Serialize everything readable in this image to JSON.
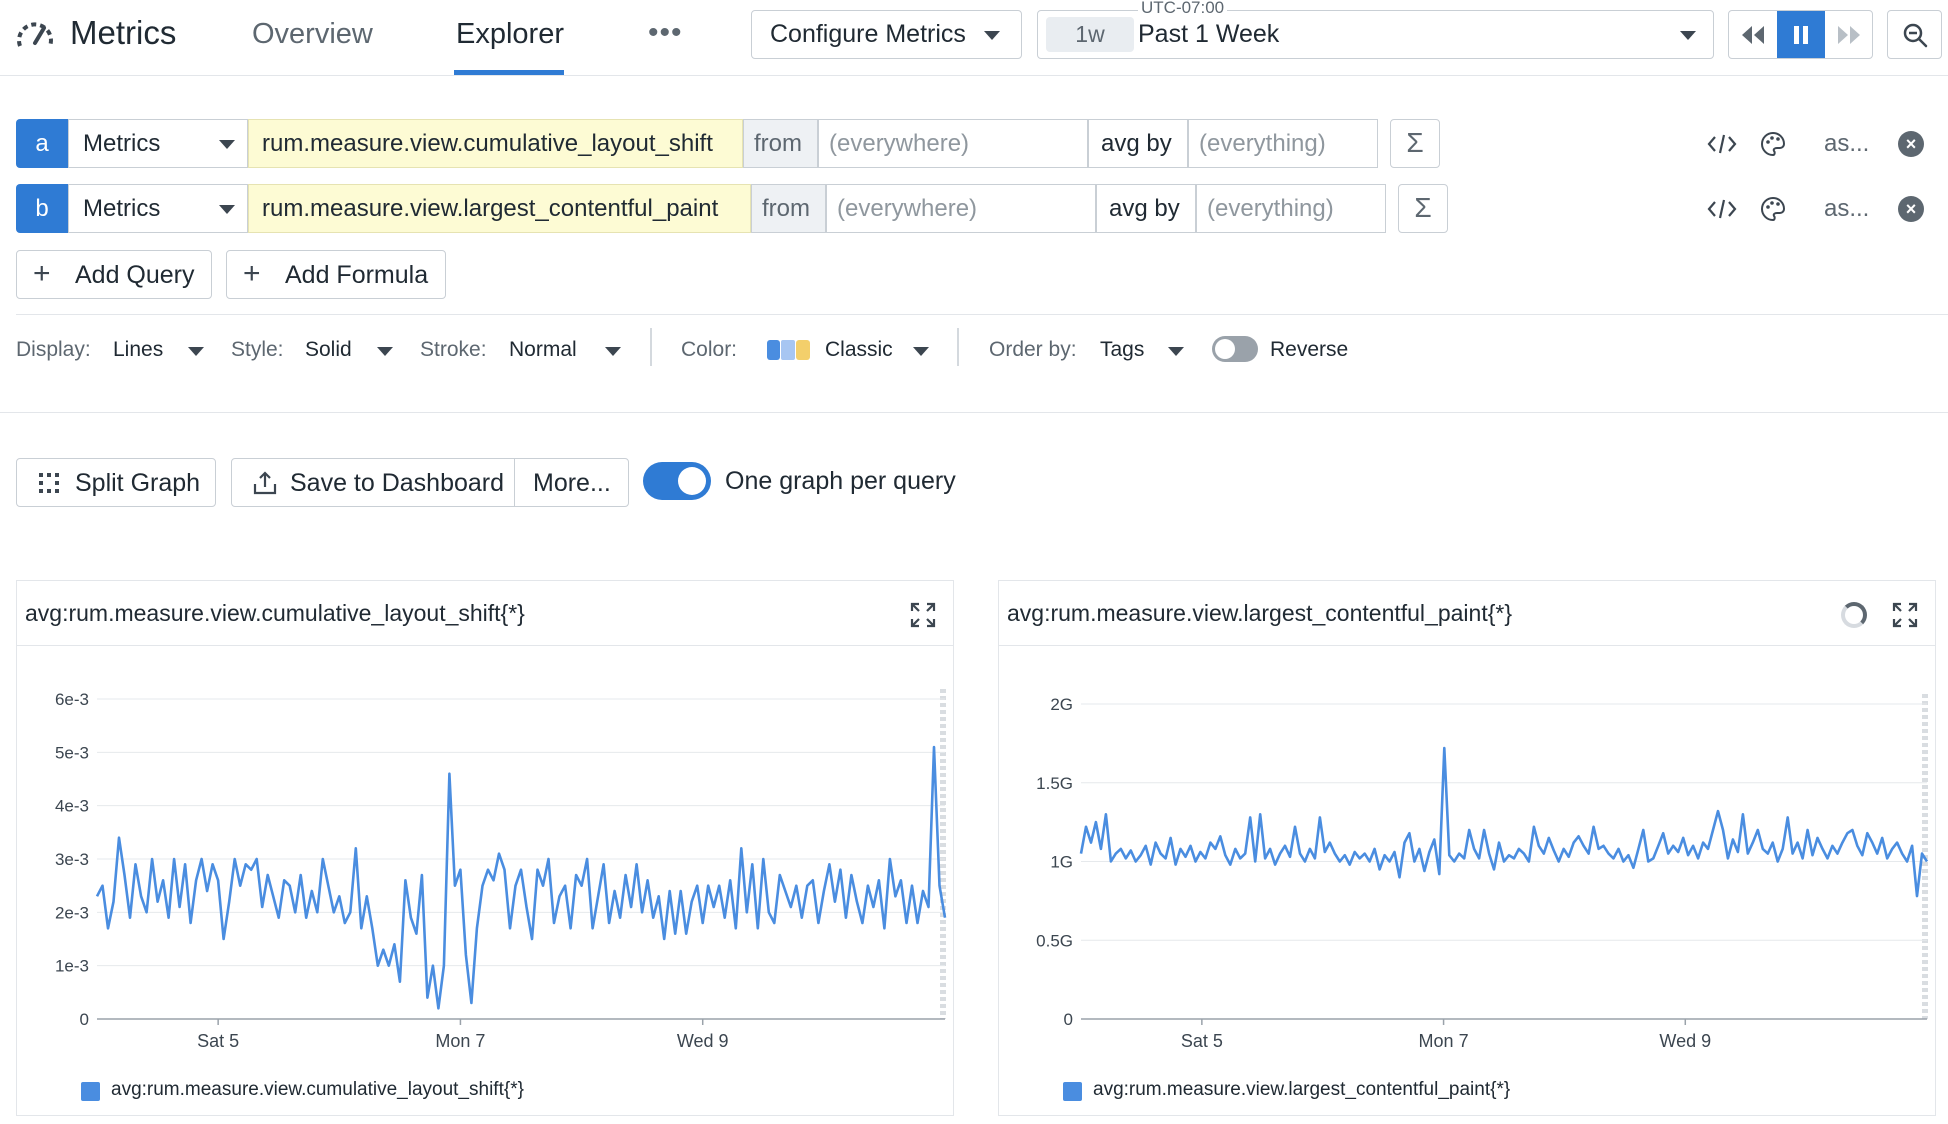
{
  "app": {
    "title": "Metrics",
    "tabs": [
      "Overview",
      "Explorer"
    ],
    "active_tab": "Explorer",
    "more_label": "•••",
    "configure_label": "Configure Metrics",
    "timezone": "UTC-07:00",
    "time_chip": "1w",
    "time_label": "Past 1 Week"
  },
  "queries": [
    {
      "letter": "a",
      "source": "Metrics",
      "metric": "rum.measure.view.cumulative_layout_shift",
      "from_label": "from",
      "from_placeholder": "(everywhere)",
      "avg_label": "avg by",
      "by_placeholder": "(everything)",
      "sigma": "Σ",
      "as_label": "as..."
    },
    {
      "letter": "b",
      "source": "Metrics",
      "metric": "rum.measure.view.largest_contentful_paint",
      "from_label": "from",
      "from_placeholder": "(everywhere)",
      "avg_label": "avg by",
      "by_placeholder": "(everything)",
      "sigma": "Σ",
      "as_label": "as..."
    }
  ],
  "add_query_label": "Add Query",
  "add_formula_label": "Add Formula",
  "display_options": {
    "display_key": "Display:",
    "display_value": "Lines",
    "style_key": "Style:",
    "style_value": "Solid",
    "stroke_key": "Stroke:",
    "stroke_value": "Normal",
    "color_key": "Color:",
    "color_value": "Classic",
    "order_key": "Order by:",
    "order_value": "Tags",
    "reverse_label": "Reverse",
    "reverse_on": false
  },
  "actions": {
    "split_graph": "Split Graph",
    "save_dashboard": "Save to Dashboard",
    "more": "More...",
    "one_graph_label": "One graph per query",
    "one_graph_on": true
  },
  "colors": {
    "accent": "#2f7bd4",
    "series": "#4a8de0"
  },
  "chart_data": [
    {
      "type": "line",
      "title": "avg:rum.measure.view.cumulative_layout_shift{*}",
      "legend": "avg:rum.measure.view.cumulative_layout_shift{*}",
      "ylim": [
        0,
        0.006
      ],
      "yticks": [
        0,
        0.001,
        0.002,
        0.003,
        0.004,
        0.005,
        0.006
      ],
      "ytick_labels": [
        "0",
        "1e-3",
        "2e-3",
        "3e-3",
        "4e-3",
        "5e-3",
        "6e-3"
      ],
      "xlim": [
        0,
        7
      ],
      "xticks": [
        1,
        3,
        5
      ],
      "xtick_labels": [
        "Sat 5",
        "Mon 7",
        "Wed 9"
      ],
      "series": [
        {
          "name": "avg:rum.measure.view.cumulative_layout_shift{*}",
          "values": [
            0.0023,
            0.0025,
            0.0017,
            0.0022,
            0.0034,
            0.0027,
            0.0019,
            0.0029,
            0.0023,
            0.002,
            0.003,
            0.0022,
            0.0026,
            0.0019,
            0.003,
            0.0021,
            0.0029,
            0.0018,
            0.0026,
            0.003,
            0.0024,
            0.0029,
            0.0026,
            0.0015,
            0.0022,
            0.003,
            0.0025,
            0.0029,
            0.0028,
            0.003,
            0.0021,
            0.0027,
            0.0023,
            0.0019,
            0.0026,
            0.0025,
            0.002,
            0.0027,
            0.0019,
            0.0024,
            0.002,
            0.003,
            0.0025,
            0.002,
            0.0023,
            0.0018,
            0.002,
            0.0032,
            0.0017,
            0.0023,
            0.0017,
            0.001,
            0.0013,
            0.001,
            0.0014,
            0.0007,
            0.0026,
            0.0019,
            0.0016,
            0.0027,
            0.0004,
            0.001,
            0.0002,
            0.001,
            0.0046,
            0.0025,
            0.0028,
            0.0012,
            0.0003,
            0.0017,
            0.0025,
            0.0028,
            0.0026,
            0.0031,
            0.0028,
            0.0017,
            0.0025,
            0.0028,
            0.0021,
            0.0015,
            0.0028,
            0.0025,
            0.003,
            0.0018,
            0.0023,
            0.0025,
            0.0017,
            0.0027,
            0.0025,
            0.003,
            0.0017,
            0.0023,
            0.0029,
            0.0018,
            0.0024,
            0.0019,
            0.0027,
            0.0021,
            0.0029,
            0.002,
            0.0026,
            0.0019,
            0.0023,
            0.0015,
            0.0024,
            0.0016,
            0.0024,
            0.0016,
            0.0022,
            0.0025,
            0.0018,
            0.0025,
            0.0021,
            0.0025,
            0.0019,
            0.0026,
            0.0017,
            0.0032,
            0.002,
            0.0029,
            0.0017,
            0.003,
            0.002,
            0.0018,
            0.0027,
            0.0024,
            0.0021,
            0.0025,
            0.0019,
            0.0025,
            0.0026,
            0.0018,
            0.0024,
            0.0029,
            0.0022,
            0.0028,
            0.0019,
            0.0027,
            0.0022,
            0.0018,
            0.0025,
            0.0021,
            0.0026,
            0.0017,
            0.003,
            0.0023,
            0.0026,
            0.0018,
            0.0025,
            0.0018,
            0.0024,
            0.0021,
            0.0051,
            0.0025,
            0.0019
          ]
        }
      ]
    },
    {
      "type": "line",
      "title": "avg:rum.measure.view.largest_contentful_paint{*}",
      "legend": "avg:rum.measure.view.largest_contentful_paint{*}",
      "ylim": [
        0,
        2
      ],
      "yticks": [
        0,
        0.5,
        1,
        1.5,
        2
      ],
      "ytick_labels": [
        "0",
        "0.5G",
        "1G",
        "1.5G",
        "2G"
      ],
      "xlim": [
        0,
        7
      ],
      "xticks": [
        1,
        3,
        5
      ],
      "xtick_labels": [
        "Sat 5",
        "Mon 7",
        "Wed 9"
      ],
      "series": [
        {
          "name": "avg:rum.measure.view.largest_contentful_paint{*}",
          "values": [
            1.05,
            1.22,
            1.12,
            1.25,
            1.08,
            1.3,
            1.0,
            1.05,
            1.08,
            1.02,
            1.07,
            1.0,
            1.04,
            1.1,
            0.98,
            1.12,
            1.05,
            1.02,
            1.15,
            0.98,
            1.08,
            1.03,
            1.1,
            1.0,
            1.06,
            1.02,
            1.12,
            1.08,
            1.16,
            1.04,
            0.98,
            1.08,
            1.02,
            1.05,
            1.28,
            1.0,
            1.3,
            1.02,
            1.08,
            0.98,
            1.05,
            1.1,
            1.03,
            1.22,
            1.05,
            1.0,
            1.08,
            1.02,
            1.28,
            1.06,
            1.12,
            1.05,
            1.0,
            1.04,
            0.98,
            1.06,
            1.02,
            1.05,
            1.0,
            1.08,
            0.95,
            1.04,
            1.0,
            1.06,
            0.9,
            1.12,
            1.18,
            1.0,
            1.08,
            0.94,
            1.06,
            1.14,
            0.92,
            1.72,
            1.04,
            1.0,
            1.05,
            1.02,
            1.2,
            1.08,
            1.02,
            1.2,
            1.05,
            0.95,
            1.12,
            1.0,
            1.04,
            1.02,
            1.08,
            1.05,
            1.0,
            1.22,
            1.1,
            1.05,
            1.15,
            1.07,
            1.0,
            1.08,
            1.03,
            1.12,
            1.16,
            1.1,
            1.05,
            1.22,
            1.08,
            1.1,
            1.05,
            1.02,
            1.08,
            1.0,
            1.04,
            0.96,
            1.08,
            1.2,
            1.0,
            1.02,
            1.1,
            1.18,
            1.05,
            1.1,
            1.06,
            1.15,
            1.04,
            1.1,
            1.02,
            1.12,
            1.08,
            1.2,
            1.32,
            1.2,
            1.02,
            1.14,
            1.06,
            1.3,
            1.05,
            1.12,
            1.2,
            1.08,
            1.05,
            1.12,
            1.0,
            1.08,
            1.28,
            1.05,
            1.12,
            1.02,
            1.2,
            1.04,
            1.15,
            1.08,
            1.02,
            1.1,
            1.05,
            1.12,
            1.18,
            1.2,
            1.1,
            1.04,
            1.18,
            1.12,
            1.05,
            1.15,
            1.02,
            1.08,
            1.12,
            1.05,
            1.0,
            1.1,
            0.78,
            1.05,
            1.0
          ]
        }
      ]
    }
  ]
}
